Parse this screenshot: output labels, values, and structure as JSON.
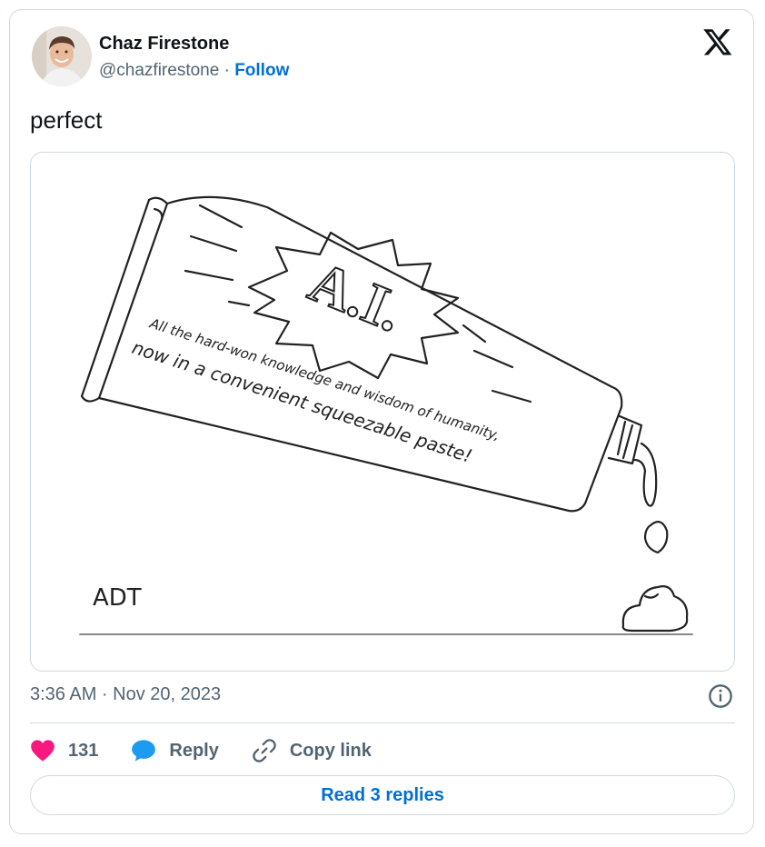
{
  "author": {
    "name": "Chaz Firestone",
    "handle": "@chazfirestone",
    "separator": "·",
    "follow_label": "Follow"
  },
  "tweet": {
    "text": "perfect",
    "timestamp": "3:36 AM · Nov 20, 2023"
  },
  "media": {
    "alt_icon": "toothpaste-cartoon",
    "tube_brand": "A.I.",
    "caption_line1": "All the hard-won knowledge and wisdom of humanity,",
    "caption_line2": "now in a convenient squeezable paste!",
    "artist_initials": "ADT"
  },
  "actions": {
    "like_count": "131",
    "reply_label": "Reply",
    "copy_label": "Copy link"
  },
  "read_replies_label": "Read 3 replies",
  "colors": {
    "accent": "#006fd6",
    "like": "#f91880",
    "reply_icon": "#1d9bf0",
    "muted": "#536471",
    "border": "#cfd9de"
  },
  "icons": [
    "x-logo-icon",
    "info-icon",
    "heart-icon",
    "reply-bubble-icon",
    "link-icon"
  ]
}
